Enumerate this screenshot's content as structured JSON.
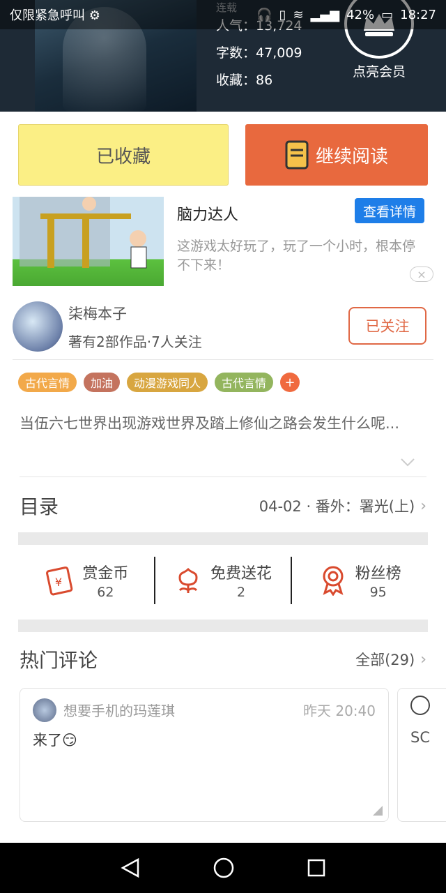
{
  "status_bar": {
    "carrier": "仅限紧急呼叫",
    "battery": "42%",
    "time": "18:27"
  },
  "book": {
    "status_partial": "连载",
    "popularity_label": "人气：",
    "popularity_value": "13,724",
    "words_label": "字数：",
    "words_value": "47,009",
    "favorites_label": "收藏：",
    "favorites_value": "86",
    "vip_label": "点亮会员"
  },
  "buttons": {
    "collected": "已收藏",
    "continue_reading": "继续阅读"
  },
  "ad": {
    "title": "脑力达人",
    "details_button": "查看详情",
    "description": "这游戏太好玩了，玩了一个小时，根本停不下来！",
    "close": "×"
  },
  "author": {
    "name": "柒梅本子",
    "meta": "著有2部作品·7人关注",
    "follow_button": "已关注"
  },
  "tags": [
    {
      "label": "古代言情",
      "color": "#f2a94a"
    },
    {
      "label": "加油",
      "color": "#c4735e"
    },
    {
      "label": "动漫游戏同人",
      "color": "#d8a640"
    },
    {
      "label": "古代言情",
      "color": "#93b55e"
    }
  ],
  "tag_more": "+",
  "description": "当伍六七世界出现游戏世界及踏上修仙之路会发生什么呢...",
  "toc": {
    "title": "目录",
    "latest": "04-02 · 番外：署光(上)"
  },
  "actions": [
    {
      "label": "赏金币",
      "value": "62",
      "icon": "red-envelope-icon"
    },
    {
      "label": "免费送花",
      "value": "2",
      "icon": "flower-icon"
    },
    {
      "label": "粉丝榜",
      "value": "95",
      "icon": "medal-icon"
    }
  ],
  "comments": {
    "title": "热门评论",
    "all_label": "全部(29)",
    "items": [
      {
        "user": "想要手机的玛莲琪",
        "time": "昨天 20:40",
        "text": "来了😏"
      },
      {
        "text": "SC"
      }
    ]
  },
  "colors": {
    "accent": "#e8693e",
    "collected_bg": "#fbef85",
    "ad_button": "#1e7ee8"
  }
}
